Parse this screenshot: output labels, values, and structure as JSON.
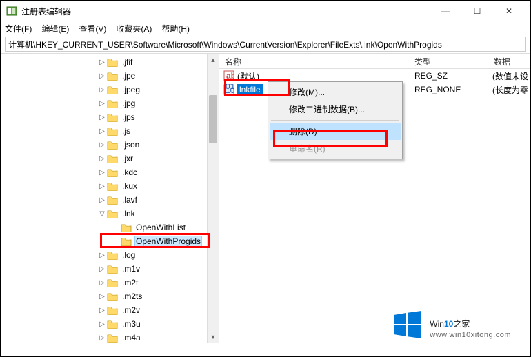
{
  "window": {
    "title": "注册表编辑器",
    "controls": {
      "min": "—",
      "max": "☐",
      "close": "✕"
    }
  },
  "menu": {
    "file": "文件(F)",
    "edit": "编辑(E)",
    "view": "查看(V)",
    "favorites": "收藏夹(A)",
    "help": "帮助(H)"
  },
  "address": "计算机\\HKEY_CURRENT_USER\\Software\\Microsoft\\Windows\\CurrentVersion\\Explorer\\FileExts\\.lnk\\OpenWithProgids",
  "tree": [
    {
      "indent": 140,
      "toggle": ">",
      "label": ".jfif"
    },
    {
      "indent": 140,
      "toggle": ">",
      "label": ".jpe"
    },
    {
      "indent": 140,
      "toggle": ">",
      "label": ".jpeg"
    },
    {
      "indent": 140,
      "toggle": ">",
      "label": ".jpg"
    },
    {
      "indent": 140,
      "toggle": ">",
      "label": ".jps"
    },
    {
      "indent": 140,
      "toggle": ">",
      "label": ".js"
    },
    {
      "indent": 140,
      "toggle": ">",
      "label": ".json"
    },
    {
      "indent": 140,
      "toggle": ">",
      "label": ".jxr"
    },
    {
      "indent": 140,
      "toggle": ">",
      "label": ".kdc"
    },
    {
      "indent": 140,
      "toggle": ">",
      "label": ".kux"
    },
    {
      "indent": 140,
      "toggle": ">",
      "label": ".lavf"
    },
    {
      "indent": 140,
      "toggle": "v",
      "label": ".lnk"
    },
    {
      "indent": 160,
      "toggle": "",
      "label": "OpenWithList"
    },
    {
      "indent": 160,
      "toggle": "",
      "label": "OpenWithProgids",
      "selected": true
    },
    {
      "indent": 140,
      "toggle": ">",
      "label": ".log"
    },
    {
      "indent": 140,
      "toggle": ">",
      "label": ".m1v"
    },
    {
      "indent": 140,
      "toggle": ">",
      "label": ".m2t"
    },
    {
      "indent": 140,
      "toggle": ">",
      "label": ".m2ts"
    },
    {
      "indent": 140,
      "toggle": ">",
      "label": ".m2v"
    },
    {
      "indent": 140,
      "toggle": ">",
      "label": ".m3u"
    },
    {
      "indent": 140,
      "toggle": ">",
      "label": ".m4a"
    }
  ],
  "list": {
    "headers": {
      "name": "名称",
      "type": "类型",
      "data": "数据"
    },
    "rows": [
      {
        "icon": "string",
        "name": "(默认)",
        "type": "REG_SZ",
        "data": "(数值未设",
        "selected": false
      },
      {
        "icon": "binary",
        "name": "lnkfile",
        "type": "REG_NONE",
        "data": "(长度为零",
        "selected": true
      }
    ]
  },
  "context_menu": {
    "modify": "修改(M)...",
    "modify_binary": "修改二进制数据(B)...",
    "delete": "删除(D)",
    "rename": "重命名(R)"
  },
  "watermark": {
    "brand_prefix": "Win",
    "brand_suffix": "10",
    "brand_tail": "之家",
    "url": "www.win10xitong.com"
  }
}
